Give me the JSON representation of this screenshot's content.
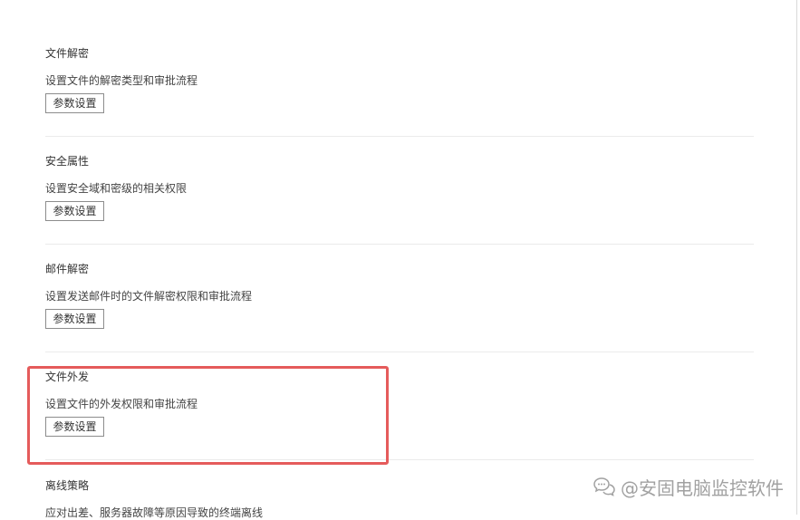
{
  "sections": [
    {
      "title": "文件解密",
      "description": "设置文件的解密类型和审批流程",
      "button_label": "参数设置"
    },
    {
      "title": "安全属性",
      "description": "设置安全域和密级的相关权限",
      "button_label": "参数设置"
    },
    {
      "title": "邮件解密",
      "description": "设置发送邮件时的文件解密权限和审批流程",
      "button_label": "参数设置"
    },
    {
      "title": "文件外发",
      "description": "设置文件的外发权限和审批流程",
      "button_label": "参数设置"
    },
    {
      "title": "离线策略",
      "description": "应对出差、服务器故障等原因导致的终端离线"
    }
  ],
  "watermark": {
    "text": "@安固电脑监控软件",
    "icon": "chat-bubbles-icon"
  },
  "colors": {
    "highlight_border": "#e55b5b",
    "divider": "#ebebeb",
    "button_border": "#8c8c8c"
  }
}
